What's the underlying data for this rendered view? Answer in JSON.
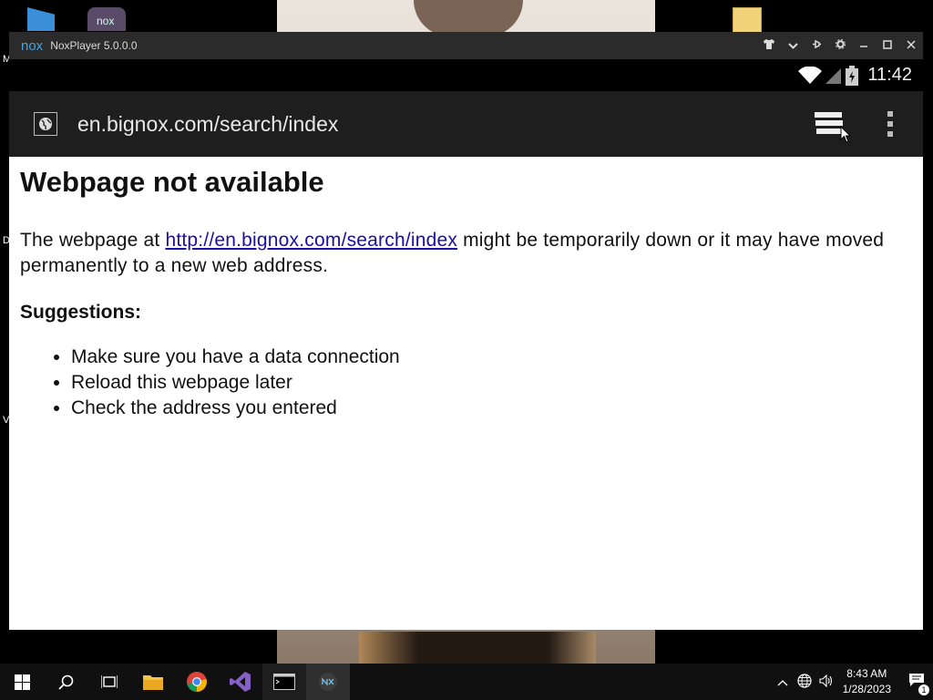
{
  "desktop": {
    "icons": [
      {
        "name": "folder"
      },
      {
        "name": "nox-app",
        "text": "nox"
      },
      {
        "name": "folder"
      }
    ],
    "edge_letters": [
      "M",
      "D",
      "V"
    ]
  },
  "window": {
    "logo": "nox",
    "title": "NoxPlayer 5.0.0.0"
  },
  "statusbar": {
    "time": "11:42"
  },
  "urlbar": {
    "url": "en.bignox.com/search/index"
  },
  "page": {
    "heading": "Webpage not available",
    "body_prefix": "The webpage at ",
    "link": "http://en.bignox.com/search/index",
    "body_suffix": " might be temporarily down or it may have moved permanently to a new web address.",
    "suggestions_label": "Suggestions:",
    "suggestions": [
      "Make sure you have a data connection",
      "Reload this webpage later",
      "Check the address you entered"
    ]
  },
  "taskbar": {
    "time": "8:43 AM",
    "date": "1/28/2023",
    "notifications": "1"
  }
}
